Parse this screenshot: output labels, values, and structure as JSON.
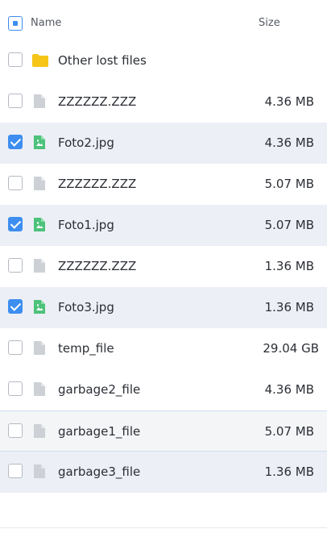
{
  "header": {
    "name_label": "Name",
    "size_label": "Size",
    "select_all_state": "indeterminate"
  },
  "colors": {
    "accent": "#3d8ef0",
    "folder": "#f5c518",
    "image_file": "#4cc27a",
    "generic_file": "#cdd1d6",
    "selected_row": "#eceff6"
  },
  "rows": [
    {
      "name": "Other lost files",
      "size": "",
      "icon": "folder-icon",
      "checked": false
    },
    {
      "name": "ZZZZZZ.ZZZ",
      "size": "4.36 MB",
      "icon": "file-icon",
      "checked": false
    },
    {
      "name": "Foto2.jpg",
      "size": "4.36 MB",
      "icon": "image-file-icon",
      "checked": true
    },
    {
      "name": "ZZZZZZ.ZZZ",
      "size": "5.07 MB",
      "icon": "file-icon",
      "checked": false
    },
    {
      "name": "Foto1.jpg",
      "size": "5.07 MB",
      "icon": "image-file-icon",
      "checked": true
    },
    {
      "name": "ZZZZZZ.ZZZ",
      "size": "1.36 MB",
      "icon": "file-icon",
      "checked": false
    },
    {
      "name": "Foto3.jpg",
      "size": "1.36 MB",
      "icon": "image-file-icon",
      "checked": true
    },
    {
      "name": "temp_file",
      "size": "29.04 GB",
      "icon": "file-icon",
      "checked": false
    },
    {
      "name": "garbage2_file",
      "size": "4.36 MB",
      "icon": "file-icon",
      "checked": false
    },
    {
      "name": "garbage1_file",
      "size": "5.07 MB",
      "icon": "file-icon",
      "checked": false
    },
    {
      "name": "garbage3_file",
      "size": "1.36 MB",
      "icon": "file-icon",
      "checked": false
    }
  ]
}
